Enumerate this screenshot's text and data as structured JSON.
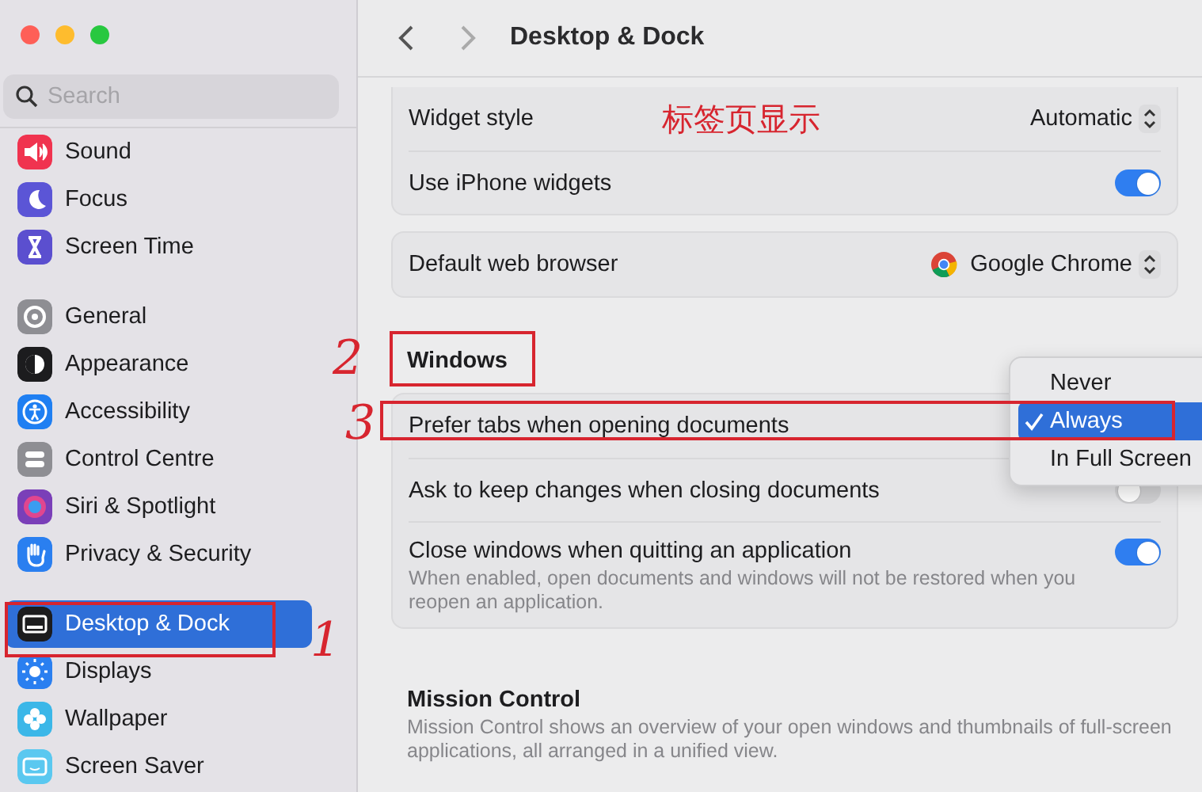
{
  "window": {
    "title": "Desktop & Dock"
  },
  "sidebar": {
    "search": {
      "placeholder": "Search"
    },
    "groups": [
      [
        {
          "label": "Sound",
          "kind": "sound",
          "selected": false
        },
        {
          "label": "Focus",
          "kind": "focus",
          "selected": false
        },
        {
          "label": "Screen Time",
          "kind": "screentime",
          "selected": false
        }
      ],
      [
        {
          "label": "General",
          "kind": "general",
          "selected": false
        },
        {
          "label": "Appearance",
          "kind": "appearance",
          "selected": false
        },
        {
          "label": "Accessibility",
          "kind": "accessibility",
          "selected": false
        },
        {
          "label": "Control Centre",
          "kind": "controlcentre",
          "selected": false
        },
        {
          "label": "Siri & Spotlight",
          "kind": "siri",
          "selected": false
        },
        {
          "label": "Privacy & Security",
          "kind": "privacy",
          "selected": false
        }
      ],
      [
        {
          "label": "Desktop & Dock",
          "kind": "desktop",
          "selected": true
        },
        {
          "label": "Displays",
          "kind": "displays",
          "selected": false
        },
        {
          "label": "Wallpaper",
          "kind": "wallpaper",
          "selected": false
        },
        {
          "label": "Screen Saver",
          "kind": "screensaver",
          "selected": false
        }
      ]
    ]
  },
  "sections": [
    {
      "rows": [
        {
          "label": "Widget style",
          "kind": "popup",
          "value": "Automatic"
        },
        {
          "label": "Use iPhone widgets",
          "kind": "toggle",
          "on": true
        }
      ]
    },
    {
      "rows": [
        {
          "label": "Default web browser",
          "kind": "browser",
          "value": "Google Chrome"
        }
      ]
    },
    {
      "title": "Windows",
      "rows": [
        {
          "label": "Prefer tabs when opening documents",
          "kind": "menu"
        },
        {
          "label": "Ask to keep changes when closing documents",
          "kind": "toggle",
          "on": false
        },
        {
          "label": "Close windows when quitting an application",
          "kind": "toggle",
          "on": true,
          "description": "When enabled, open documents and windows will not be restored when you reopen an application."
        }
      ]
    },
    {
      "title": "Mission Control",
      "description": "Mission Control shows an overview of your open windows and thumbnails of full-screen applications, all arranged in a unified view."
    }
  ],
  "menu": [
    {
      "label": "Never",
      "selected": false
    },
    {
      "label": "Always",
      "selected": true
    },
    {
      "label": "In Full Screen",
      "selected": false
    }
  ],
  "annotations": {
    "note": "标签页显示",
    "numbers": [
      "2",
      "3",
      "1"
    ]
  }
}
